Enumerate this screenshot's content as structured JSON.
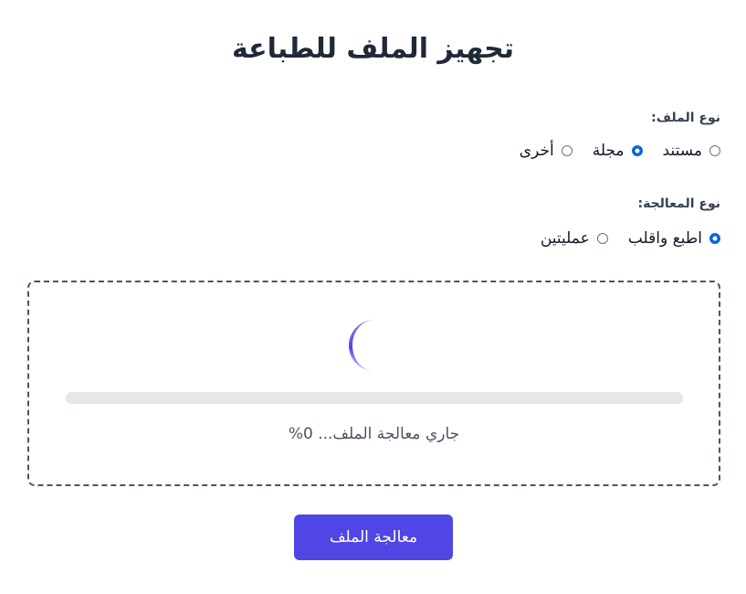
{
  "page": {
    "title": "تجهيز الملف للطباعة"
  },
  "file_type": {
    "label": "نوع الملف:",
    "options": [
      {
        "label": "مستند",
        "checked": false
      },
      {
        "label": "مجلة",
        "checked": true
      },
      {
        "label": "أخرى",
        "checked": false
      }
    ]
  },
  "processing_type": {
    "label": "نوع المعالجة:",
    "options": [
      {
        "label": "اطبع واقلب",
        "checked": true
      },
      {
        "label": "عمليتين",
        "checked": false
      }
    ]
  },
  "progress": {
    "value_percent": 0,
    "status_text": "جاري معالجة الملف... 0%"
  },
  "actions": {
    "process_label": "معالجة الملف"
  },
  "colors": {
    "accent": "#4f46e5",
    "radio_checked": "#0a66d8",
    "progress_track": "#e5e7eb"
  }
}
